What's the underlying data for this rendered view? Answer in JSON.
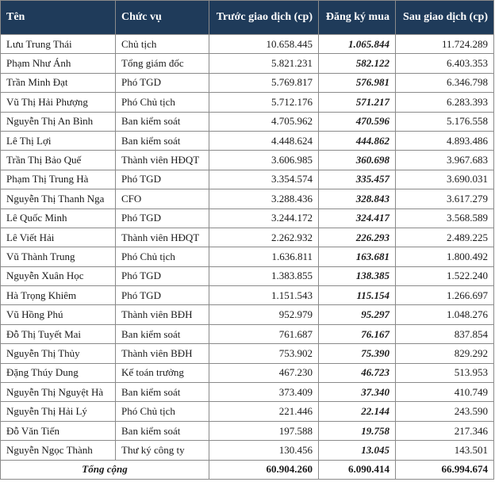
{
  "table": {
    "headers": [
      "Tên",
      "Chức vụ",
      "Trước giao dịch (cp)",
      "Đăng ký mua",
      "Sau giao dịch (cp)"
    ],
    "rows": [
      [
        "Lưu Trung Thái",
        "Chủ tịch",
        "10.658.445",
        "1.065.844",
        "11.724.289"
      ],
      [
        "Phạm Như Ánh",
        "Tổng giám đốc",
        "5.821.231",
        "582.122",
        "6.403.353"
      ],
      [
        "Trần Minh Đạt",
        "Phó TGD",
        "5.769.817",
        "576.981",
        "6.346.798"
      ],
      [
        "Vũ Thị Hải Phượng",
        "Phó Chủ tịch",
        "5.712.176",
        "571.217",
        "6.283.393"
      ],
      [
        "Nguyễn Thị An Bình",
        "Ban kiểm soát",
        "4.705.962",
        "470.596",
        "5.176.558"
      ],
      [
        "Lê Thị Lợi",
        "Ban kiểm soát",
        "4.448.624",
        "444.862",
        "4.893.486"
      ],
      [
        "Trần Thị Bảo Quế",
        "Thành viên HĐQT",
        "3.606.985",
        "360.698",
        "3.967.683"
      ],
      [
        "Phạm Thị Trung Hà",
        "Phó TGD",
        "3.354.574",
        "335.457",
        "3.690.031"
      ],
      [
        "Nguyễn Thị Thanh Nga",
        "CFO",
        "3.288.436",
        "328.843",
        "3.617.279"
      ],
      [
        "Lê Quốc Minh",
        "Phó TGD",
        "3.244.172",
        "324.417",
        "3.568.589"
      ],
      [
        "Lê Viết Hải",
        "Thành viên HĐQT",
        "2.262.932",
        "226.293",
        "2.489.225"
      ],
      [
        "Vũ Thành Trung",
        "Phó Chủ tịch",
        "1.636.811",
        "163.681",
        "1.800.492"
      ],
      [
        "Nguyễn Xuân Học",
        "Phó TGD",
        "1.383.855",
        "138.385",
        "1.522.240"
      ],
      [
        "Hà Trọng Khiêm",
        "Phó TGD",
        "1.151.543",
        "115.154",
        "1.266.697"
      ],
      [
        "Vũ Hồng Phú",
        "Thành viên BĐH",
        "952.979",
        "95.297",
        "1.048.276"
      ],
      [
        "Đỗ Thị Tuyết Mai",
        "Ban kiểm soát",
        "761.687",
        "76.167",
        "837.854"
      ],
      [
        "Nguyễn Thị Thủy",
        "Thành viên BĐH",
        "753.902",
        "75.390",
        "829.292"
      ],
      [
        "Đặng Thúy Dung",
        "Kế toán trưởng",
        "467.230",
        "46.723",
        "513.953"
      ],
      [
        "Nguyễn Thị Nguyệt Hà",
        "Ban kiểm soát",
        "373.409",
        "37.340",
        "410.749"
      ],
      [
        "Nguyễn Thị Hải Lý",
        "Phó Chủ tịch",
        "221.446",
        "22.144",
        "243.590"
      ],
      [
        "Đỗ Văn Tiến",
        "Ban kiểm soát",
        "197.588",
        "19.758",
        "217.346"
      ],
      [
        "Nguyễn Ngọc Thành",
        "Thư ký công ty",
        "130.456",
        "13.045",
        "143.501"
      ]
    ],
    "total": {
      "label": "Tổng cộng",
      "before": "60.904.260",
      "subscribed": "6.090.414",
      "after": "66.994.674"
    }
  },
  "colors": {
    "header_bg": "#1f3b5a",
    "header_text": "#ffffff",
    "border": "#8a8a8a"
  }
}
